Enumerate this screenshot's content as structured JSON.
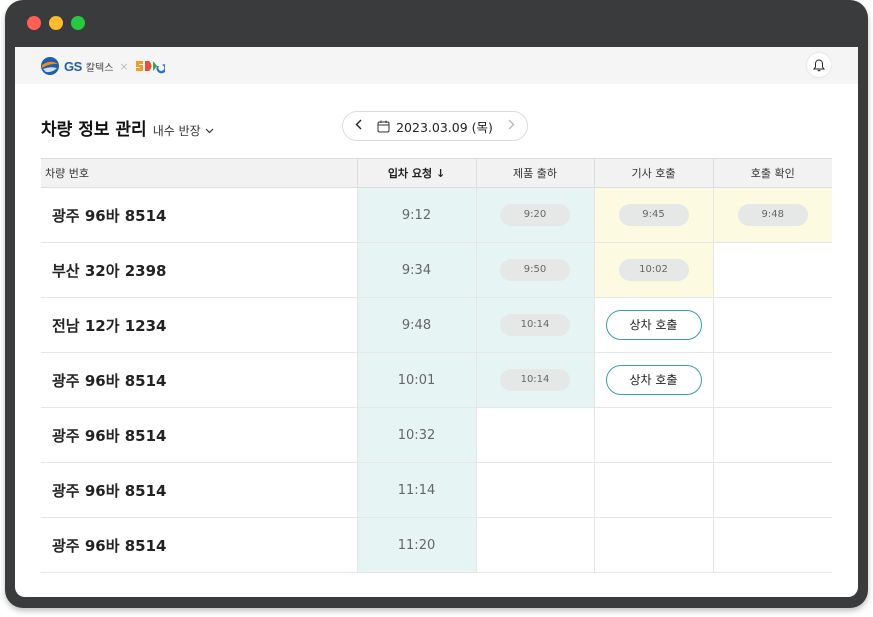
{
  "brand": {
    "gs_text": "GS",
    "gs_kr": "칼텍스",
    "separator": "×",
    "colors": {
      "gs_blue": "#1f5ea8",
      "gs_orange": "#f08a24",
      "partner_orange": "#f39a2a",
      "partner_green": "#2fa84f",
      "partner_blue": "#2a6fd6"
    }
  },
  "header": {
    "title": "차량 정보 관리",
    "branch": "내수 반장",
    "date": "2023.03.09 (목)"
  },
  "icons": {
    "bell": "bell-icon",
    "calendar": "calendar-icon",
    "prev": "chevron-left-icon",
    "next": "chevron-right-icon",
    "dropdown": "chevron-down-icon",
    "sort": "arrow-down-icon"
  },
  "table": {
    "columns": [
      "차량 번호",
      "입차 요청",
      "제품 출하",
      "기사 호출",
      "호출 확인"
    ],
    "sort_arrow": "↓",
    "call_button_label": "상차 호출",
    "rows": [
      {
        "vehicle": "광주 96바 8514",
        "request": "9:12",
        "ship": "9:20",
        "call": "9:45",
        "confirm": "9:48"
      },
      {
        "vehicle": "부산 32아 2398",
        "request": "9:34",
        "ship": "9:50",
        "call": "10:02",
        "confirm": ""
      },
      {
        "vehicle": "전남 12가 1234",
        "request": "9:48",
        "ship": "10:14",
        "call": "상차 호출",
        "confirm": ""
      },
      {
        "vehicle": "광주 96바 8514",
        "request": "10:01",
        "ship": "10:14",
        "call": "상차 호출",
        "confirm": ""
      },
      {
        "vehicle": "광주 96바 8514",
        "request": "10:32",
        "ship": "",
        "call": "",
        "confirm": ""
      },
      {
        "vehicle": "광주 96바 8514",
        "request": "11:14",
        "ship": "",
        "call": "",
        "confirm": ""
      },
      {
        "vehicle": "광주 96바 8514",
        "request": "11:20",
        "ship": "",
        "call": "",
        "confirm": ""
      }
    ]
  },
  "colors": {
    "request_bg": "#e7f4f4",
    "call_bg": "#fcfae0",
    "button_border": "#3a9ea5",
    "window_frame": "#3a3b3d"
  }
}
